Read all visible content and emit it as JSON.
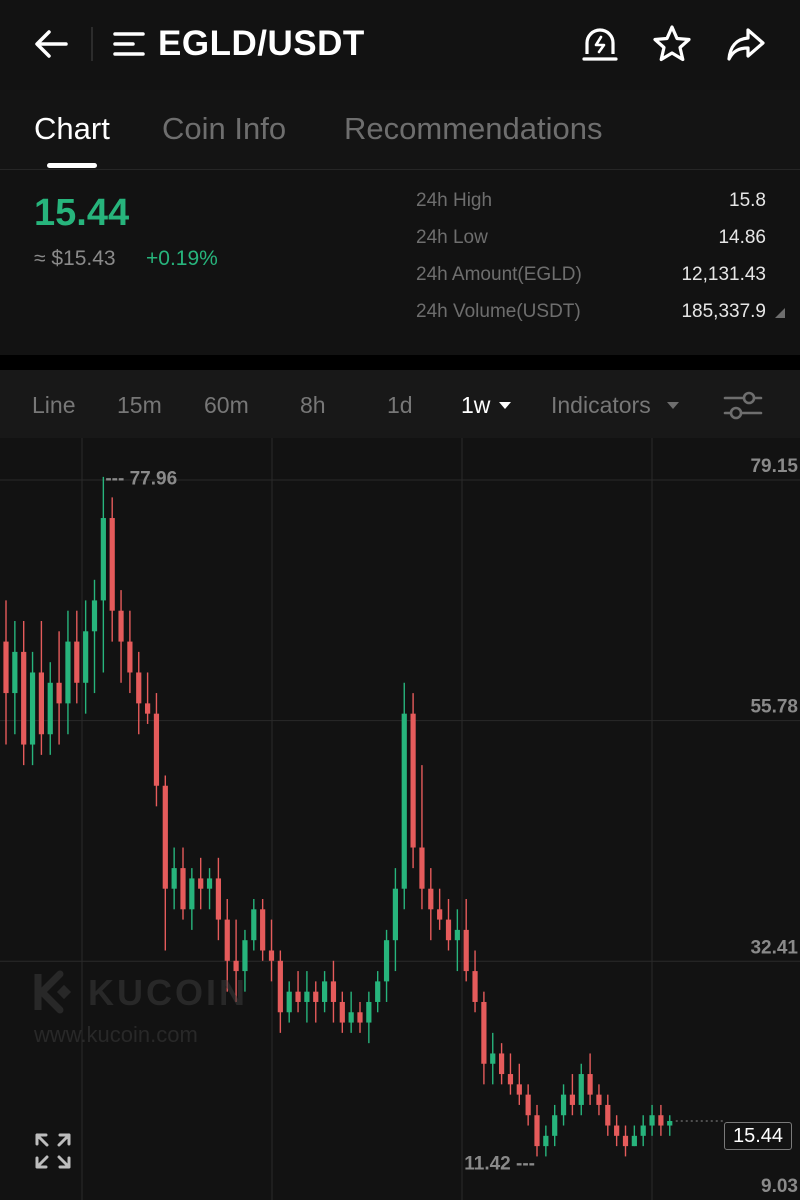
{
  "header": {
    "pair": "EGLD/USDT",
    "icons": [
      "back-arrow-icon",
      "menu-icon",
      "price-alert-icon",
      "star-icon",
      "share-icon"
    ]
  },
  "tabs": [
    {
      "label": "Chart",
      "active": true
    },
    {
      "label": "Coin Info",
      "active": false
    },
    {
      "label": "Recommendations",
      "active": false
    }
  ],
  "ticker": {
    "last_price": "15.44",
    "fiat_price": "≈ $15.43",
    "change": "+0.19%",
    "stats": [
      {
        "label": "24h High",
        "value": "15.8"
      },
      {
        "label": "24h Low",
        "value": "14.86"
      },
      {
        "label": "24h Amount(EGLD)",
        "value": "12,131.43"
      },
      {
        "label": "24h Volume(USDT)",
        "value": "185,337.9"
      }
    ]
  },
  "toolbar": {
    "timeframes": [
      "Line",
      "15m",
      "60m",
      "8h",
      "1d",
      "1w"
    ],
    "active_timeframe": "1w",
    "indicators_label": "Indicators"
  },
  "colors": {
    "up": "#27b47c",
    "down": "#e55b5b",
    "background": "#121212",
    "grid": "#2a2a2a"
  },
  "watermark": {
    "name": "KUCOIN",
    "url": "www.kucoin.com"
  },
  "chart_data": {
    "type": "candlestick",
    "interval": "1w",
    "y_ticks": [
      "79.15",
      "55.78",
      "32.41",
      "9.03"
    ],
    "ylim": [
      9.03,
      79.15
    ],
    "max_marker": 77.96,
    "min_marker": 11.42,
    "max_label": "77.96",
    "min_label": "11.42",
    "last_price": 15.44,
    "last_price_label": "15.44",
    "candles": [
      {
        "o": 62,
        "h": 66,
        "l": 52,
        "c": 57
      },
      {
        "o": 57,
        "h": 64,
        "l": 53,
        "c": 61
      },
      {
        "o": 61,
        "h": 64,
        "l": 50,
        "c": 52
      },
      {
        "o": 52,
        "h": 61,
        "l": 50,
        "c": 59
      },
      {
        "o": 59,
        "h": 64,
        "l": 51,
        "c": 53
      },
      {
        "o": 53,
        "h": 60,
        "l": 51,
        "c": 58
      },
      {
        "o": 58,
        "h": 63,
        "l": 52,
        "c": 56
      },
      {
        "o": 56,
        "h": 65,
        "l": 53,
        "c": 62
      },
      {
        "o": 62,
        "h": 65,
        "l": 56,
        "c": 58
      },
      {
        "o": 58,
        "h": 66,
        "l": 55,
        "c": 63
      },
      {
        "o": 63,
        "h": 68,
        "l": 57,
        "c": 66
      },
      {
        "o": 66,
        "h": 78,
        "l": 59,
        "c": 74
      },
      {
        "o": 74,
        "h": 76,
        "l": 62,
        "c": 65
      },
      {
        "o": 65,
        "h": 67,
        "l": 58,
        "c": 62
      },
      {
        "o": 62,
        "h": 65,
        "l": 57,
        "c": 59
      },
      {
        "o": 59,
        "h": 61,
        "l": 53,
        "c": 56
      },
      {
        "o": 56,
        "h": 59,
        "l": 54,
        "c": 55
      },
      {
        "o": 55,
        "h": 57,
        "l": 46,
        "c": 48
      },
      {
        "o": 48,
        "h": 49,
        "l": 32,
        "c": 38
      },
      {
        "o": 38,
        "h": 42,
        "l": 36,
        "c": 40
      },
      {
        "o": 40,
        "h": 42,
        "l": 35,
        "c": 36
      },
      {
        "o": 36,
        "h": 40,
        "l": 34,
        "c": 39
      },
      {
        "o": 39,
        "h": 41,
        "l": 36,
        "c": 38
      },
      {
        "o": 38,
        "h": 40,
        "l": 36,
        "c": 39
      },
      {
        "o": 39,
        "h": 41,
        "l": 33,
        "c": 35
      },
      {
        "o": 35,
        "h": 37,
        "l": 28,
        "c": 31
      },
      {
        "o": 31,
        "h": 35,
        "l": 27,
        "c": 30
      },
      {
        "o": 30,
        "h": 34,
        "l": 28,
        "c": 33
      },
      {
        "o": 33,
        "h": 37,
        "l": 32,
        "c": 36
      },
      {
        "o": 36,
        "h": 37,
        "l": 31,
        "c": 32
      },
      {
        "o": 32,
        "h": 35,
        "l": 29,
        "c": 31
      },
      {
        "o": 31,
        "h": 32,
        "l": 24,
        "c": 26
      },
      {
        "o": 26,
        "h": 29,
        "l": 25,
        "c": 28
      },
      {
        "o": 28,
        "h": 30,
        "l": 26,
        "c": 27
      },
      {
        "o": 27,
        "h": 30,
        "l": 25,
        "c": 28
      },
      {
        "o": 28,
        "h": 29,
        "l": 25,
        "c": 27
      },
      {
        "o": 27,
        "h": 30,
        "l": 26,
        "c": 29
      },
      {
        "o": 29,
        "h": 31,
        "l": 25,
        "c": 27
      },
      {
        "o": 27,
        "h": 28,
        "l": 24,
        "c": 25
      },
      {
        "o": 25,
        "h": 28,
        "l": 24,
        "c": 26
      },
      {
        "o": 26,
        "h": 27,
        "l": 24,
        "c": 25
      },
      {
        "o": 25,
        "h": 28,
        "l": 23,
        "c": 27
      },
      {
        "o": 27,
        "h": 30,
        "l": 26,
        "c": 29
      },
      {
        "o": 29,
        "h": 34,
        "l": 27,
        "c": 33
      },
      {
        "o": 33,
        "h": 40,
        "l": 30,
        "c": 38
      },
      {
        "o": 38,
        "h": 58,
        "l": 36,
        "c": 55
      },
      {
        "o": 55,
        "h": 57,
        "l": 40,
        "c": 42
      },
      {
        "o": 42,
        "h": 50,
        "l": 36,
        "c": 38
      },
      {
        "o": 38,
        "h": 40,
        "l": 33,
        "c": 36
      },
      {
        "o": 36,
        "h": 38,
        "l": 34,
        "c": 35
      },
      {
        "o": 35,
        "h": 37,
        "l": 32,
        "c": 33
      },
      {
        "o": 33,
        "h": 36,
        "l": 30,
        "c": 34
      },
      {
        "o": 34,
        "h": 37,
        "l": 29,
        "c": 30
      },
      {
        "o": 30,
        "h": 32,
        "l": 26,
        "c": 27
      },
      {
        "o": 27,
        "h": 28,
        "l": 19,
        "c": 21
      },
      {
        "o": 21,
        "h": 24,
        "l": 19,
        "c": 22
      },
      {
        "o": 22,
        "h": 23,
        "l": 19,
        "c": 20
      },
      {
        "o": 20,
        "h": 22,
        "l": 18,
        "c": 19
      },
      {
        "o": 19,
        "h": 21,
        "l": 17,
        "c": 18
      },
      {
        "o": 18,
        "h": 19,
        "l": 15,
        "c": 16
      },
      {
        "o": 16,
        "h": 17,
        "l": 12,
        "c": 13
      },
      {
        "o": 13,
        "h": 15,
        "l": 12,
        "c": 14
      },
      {
        "o": 14,
        "h": 17,
        "l": 13,
        "c": 16
      },
      {
        "o": 16,
        "h": 19,
        "l": 15,
        "c": 18
      },
      {
        "o": 18,
        "h": 20,
        "l": 16,
        "c": 17
      },
      {
        "o": 17,
        "h": 21,
        "l": 16,
        "c": 20
      },
      {
        "o": 20,
        "h": 22,
        "l": 17,
        "c": 18
      },
      {
        "o": 18,
        "h": 19,
        "l": 16,
        "c": 17
      },
      {
        "o": 17,
        "h": 18,
        "l": 14,
        "c": 15
      },
      {
        "o": 15,
        "h": 16,
        "l": 13,
        "c": 14
      },
      {
        "o": 14,
        "h": 15,
        "l": 12,
        "c": 13
      },
      {
        "o": 13,
        "h": 15,
        "l": 13,
        "c": 14
      },
      {
        "o": 14,
        "h": 16,
        "l": 13,
        "c": 15
      },
      {
        "o": 15,
        "h": 17,
        "l": 14,
        "c": 16
      },
      {
        "o": 16,
        "h": 17,
        "l": 14,
        "c": 15
      },
      {
        "o": 15,
        "h": 16,
        "l": 14,
        "c": 15.44
      }
    ]
  }
}
